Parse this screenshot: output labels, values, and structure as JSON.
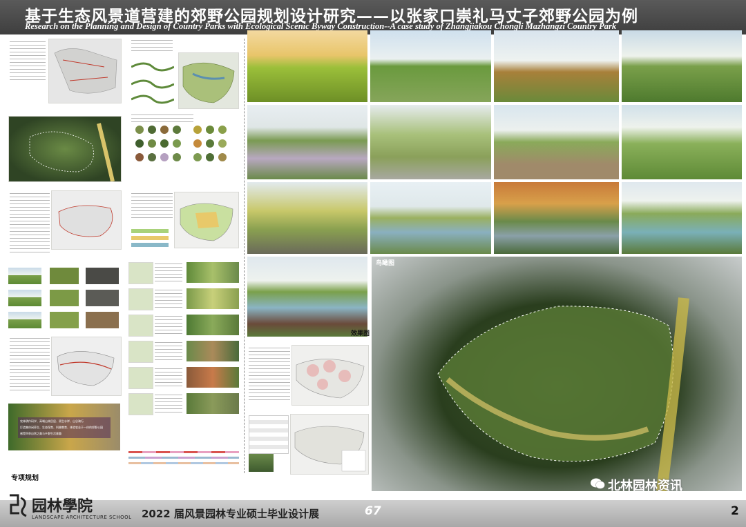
{
  "header": {
    "title_cn": "基于生态风景道营建的郊野公园规划设计研究——以张家口崇礼马丈子郊野公园为例",
    "title_en": "Research on the Planning and Design of Country Parks with Ecological Scenic Byway Construction--A case study of Zhangjiakou Chongli Mazhangzi Country Park"
  },
  "left_panel": {
    "caption": "专项规划",
    "slogan_lines": [
      "农林耕作研学、高端山林民居、原生水岸、山谷骑行",
      "打造集休闲养生、生态保育、科普教育、体验农业于一体的郊野公园",
      "感受四季自然之美与乡野生活意趣"
    ]
  },
  "gallery": {
    "effects_caption": "效果图",
    "aerial_caption": "鸟瞰图"
  },
  "footer": {
    "school_name": "园林學院",
    "school_en": "LANDSCAPE ARCHITECTURE SCHOOL",
    "exhibition": "2022 届风景园林专业硕士毕业设计展",
    "exhibition_number": "67",
    "page_number": "2",
    "watermark": "北林园林资讯"
  },
  "colors": {
    "header_bg": "#4a4a4a",
    "footer_band": "#b5b5b5",
    "accent_green": "#6b8f2f",
    "accent_red": "#d9534f"
  }
}
